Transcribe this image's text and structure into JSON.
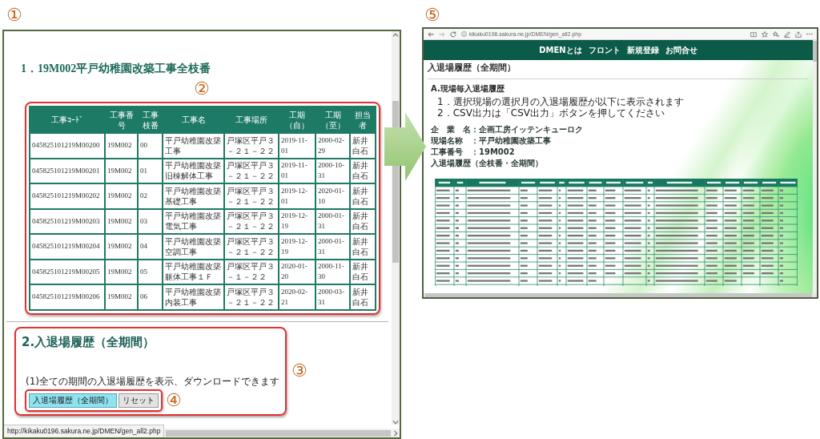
{
  "left_window": {
    "marker": "①",
    "heading": "1．19M002平戸幼稚園改築工事全枝番",
    "table_marker": "②",
    "table": {
      "columns": [
        "工事ｺｰﾄﾞ",
        "工事番号",
        "工事枝番",
        "工事名",
        "工事場所",
        "工期（自）",
        "工期（至）",
        "担当者"
      ],
      "rows": [
        [
          "045825101219M00200",
          "19M002",
          "00",
          "平戸幼稚園改築工事",
          "戸塚区平戸３－２１－２２",
          "2019-11-01",
          "2000-02-29",
          "新井白石"
        ],
        [
          "045825101219M00201",
          "19M002",
          "01",
          "平戸幼稚園改築旧棟解体工事",
          "戸塚区平戸３－２１－２２",
          "2019-11-01",
          "2000-10-31",
          "新井白石"
        ],
        [
          "045825101219M00202",
          "19M002",
          "02",
          "平戸幼稚園改築基礎工事",
          "戸塚区平戸３－２１－２２",
          "2019-12-01",
          "2020-01-10",
          "新井白石"
        ],
        [
          "045825101219M00203",
          "19M002",
          "03",
          "平戸幼稚園改築電気工事",
          "戸塚区平戸３－２１－２２",
          "2019-12-19",
          "2000-01-31",
          "新井白石"
        ],
        [
          "045825101219M00204",
          "19M002",
          "04",
          "平戸幼稚園改築空調工事",
          "戸塚区平戸３－２１－２２",
          "2019-12-19",
          "2000-01-31",
          "新井白石"
        ],
        [
          "045825101219M00205",
          "19M002",
          "05",
          "平戸幼稚園改築躯体工事１Ｆ",
          "戸塚区平戸３－１－２２",
          "2020-01-20",
          "2000-11-30",
          "新井白石"
        ],
        [
          "045825101219M00206",
          "19M002",
          "06",
          "平戸幼稚園改築内装工事",
          "戸塚区平戸３－２１－２２",
          "2020-02-21",
          "2000-03-31",
          "新井白石"
        ]
      ]
    },
    "history": {
      "heading": "2.入退場履歴（全期間）",
      "description": "(1)全ての期間の入退場履歴を表示、ダウンロードできます",
      "marker": "③",
      "buttons_marker": "④",
      "buttons": [
        {
          "label": "入退場履歴（全期間）",
          "kind": "primary"
        },
        {
          "label": "リセット",
          "kind": "secondary"
        }
      ]
    },
    "status_url": "http://kikaku0196.sakura.ne.jp/DMEN/gen_all2.php"
  },
  "right_window": {
    "marker": "⑤",
    "address": "kikaku0196.sakura.ne.jp/DMEN/gen_all2.php",
    "nav": [
      "DMENとは",
      "フロント",
      "新規登録",
      "お問合せ"
    ],
    "title": "入退場履歴（全期間）",
    "section_heading": "A.現場毎入退場履歴",
    "instructions": [
      "1．選択現場の選択月の入退場履歴が以下に表示されます",
      "2．CSV出力は「CSV出力」ボタンを押してください"
    ],
    "details": [
      "企　業　名：企画工房イッテンキューロク",
      "現場名称　：平戸幼稚園改築工事",
      "工事番号　：19M002"
    ],
    "table_caption": "入退場履歴（全枝番・全期間）"
  }
}
